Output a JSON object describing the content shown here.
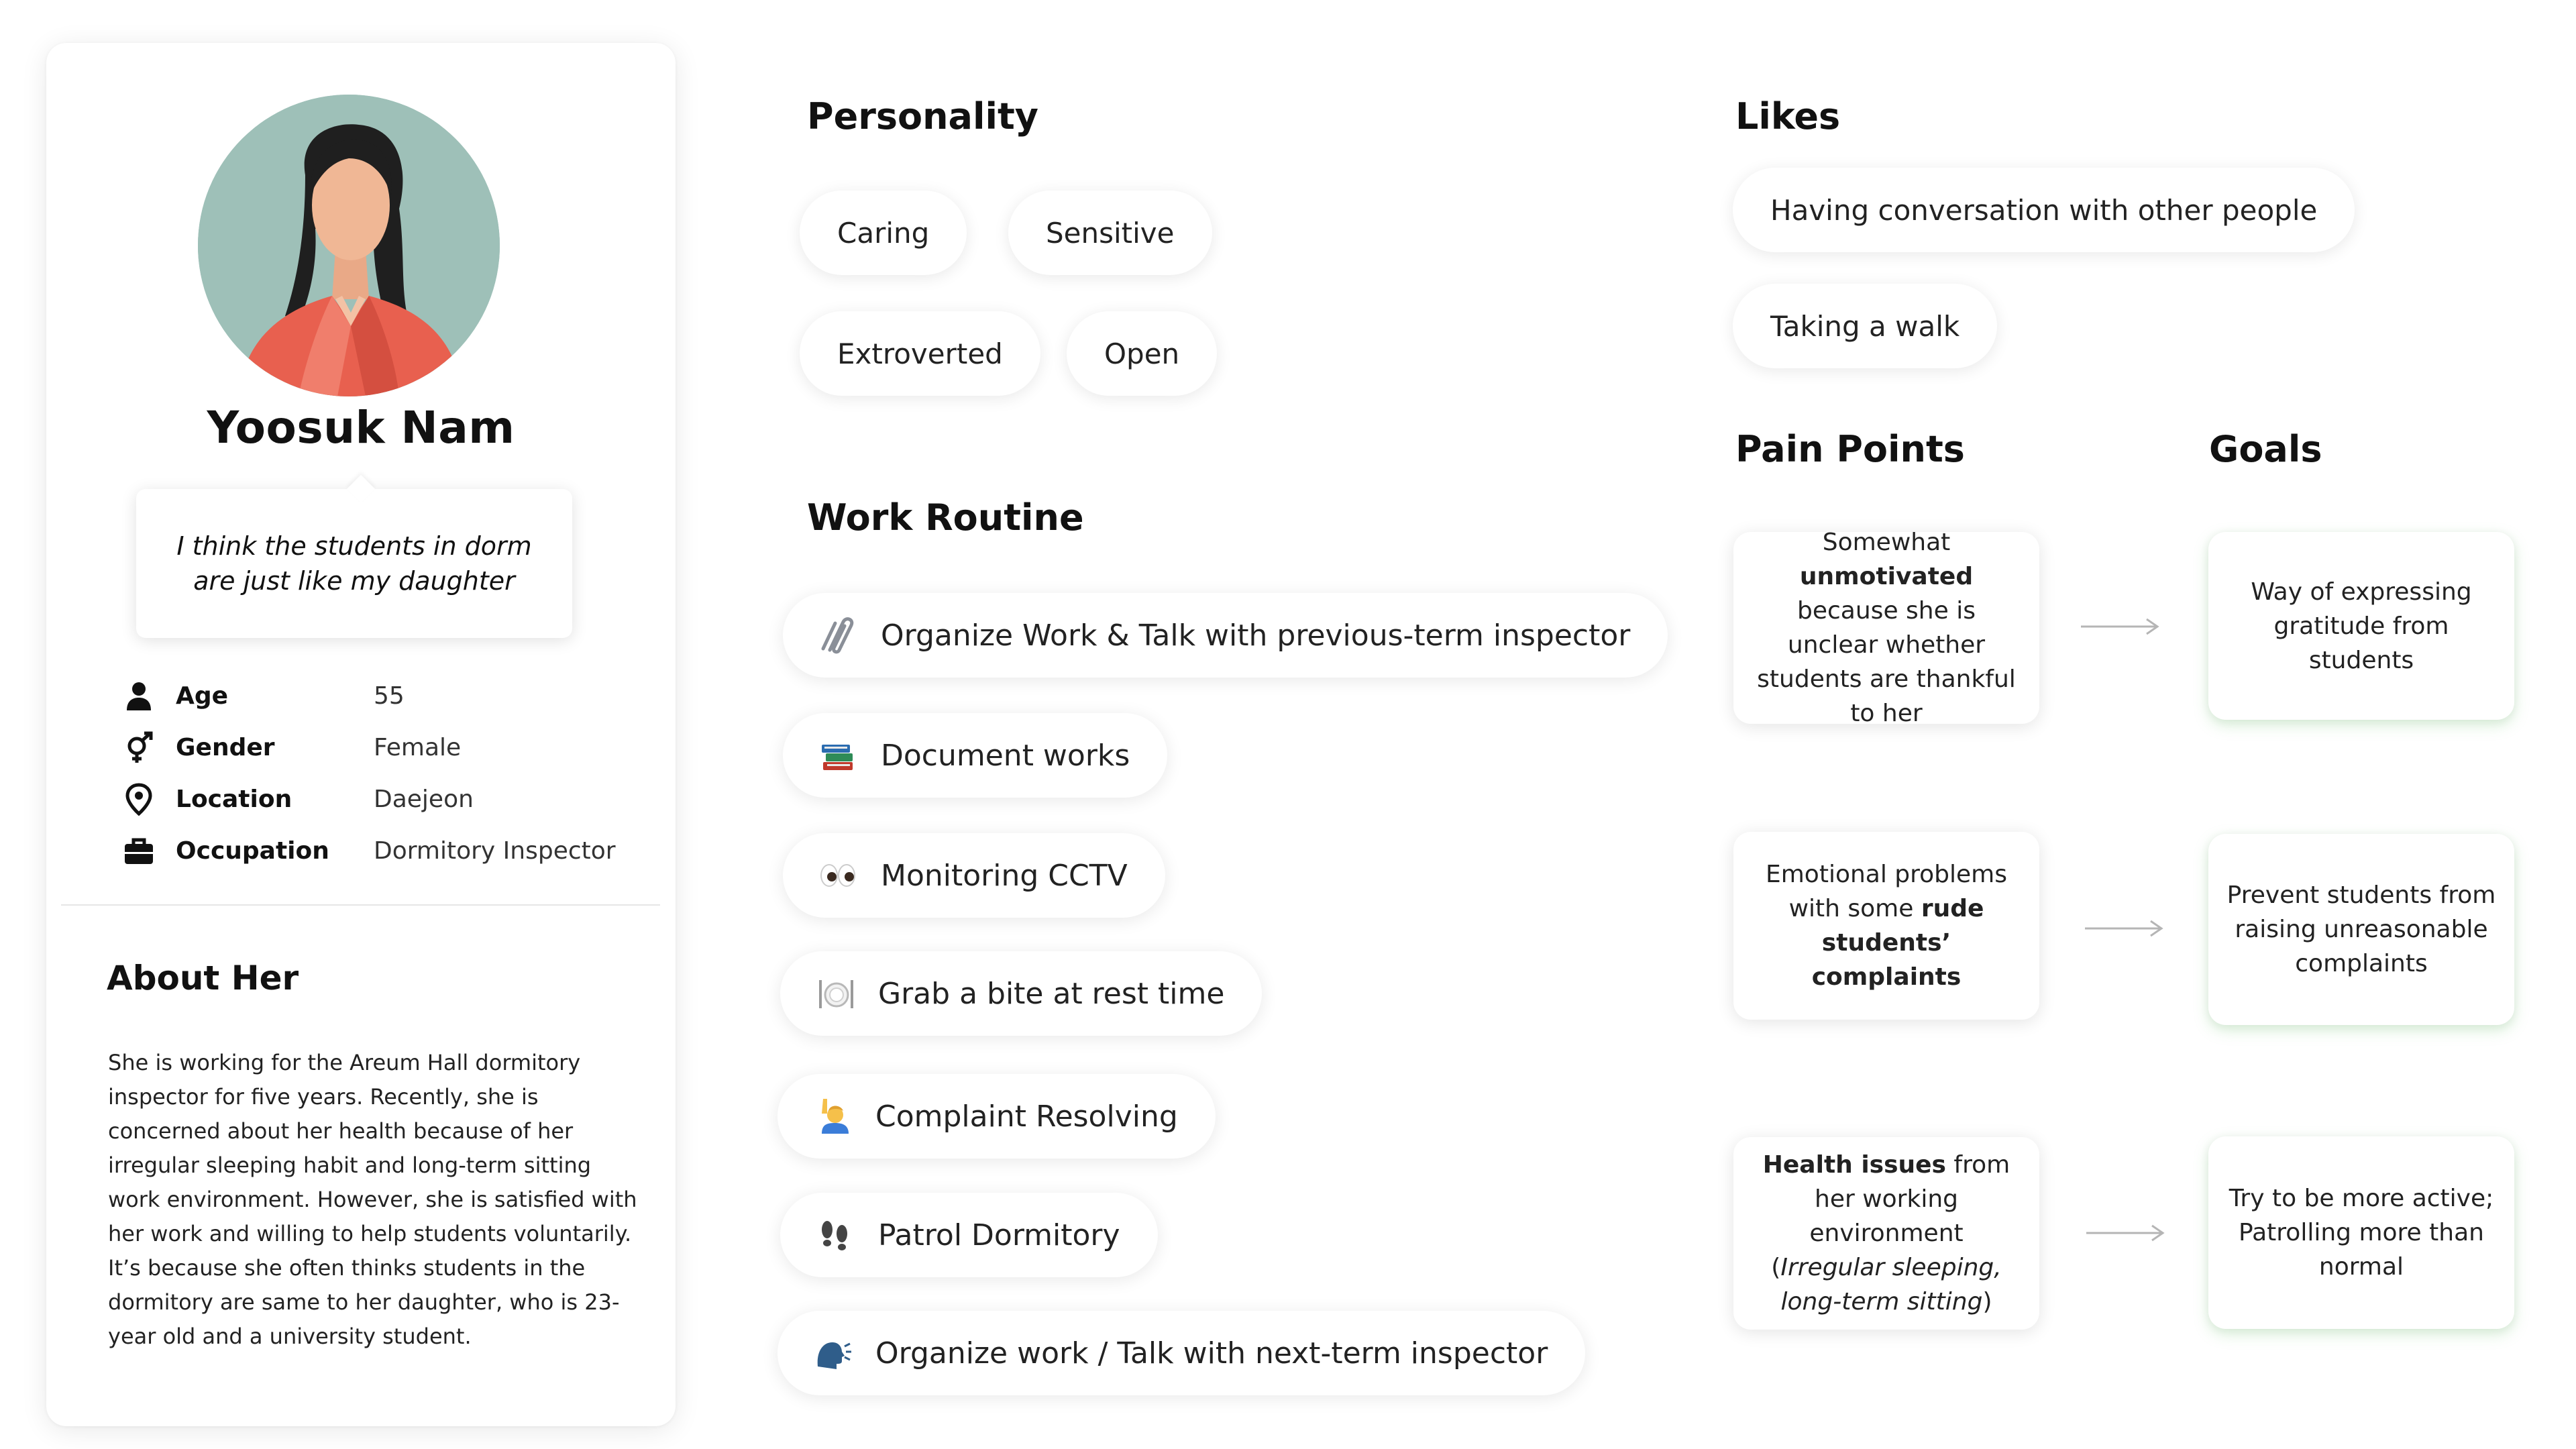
{
  "profile": {
    "name": "Yoosuk Nam",
    "quote": "I think the students in dorm are just like my daughter",
    "info": [
      {
        "icon": "person-icon",
        "label": "Age",
        "value": "55"
      },
      {
        "icon": "gender-icon",
        "label": "Gender",
        "value": "Female"
      },
      {
        "icon": "location-pin-icon",
        "label": "Location",
        "value": "Daejeon"
      },
      {
        "icon": "briefcase-icon",
        "label": "Occupation",
        "value": "Dormitory Inspector"
      }
    ],
    "about_title": "About Her",
    "about_text": "She is working for the Areum Hall dormitory inspector for five years. Recently, she is concerned about her health because of her irregular sleeping habit and long-term sitting work environment. However, she is satisfied with her work and willing to help students voluntarily. It’s because she often thinks students in the dormitory are same to her daughter, who is 23-year old and a university student."
  },
  "personality": {
    "title": "Personality",
    "traits": [
      "Caring",
      "Sensitive",
      "Extroverted",
      "Open"
    ]
  },
  "work_routine": {
    "title": "Work Routine",
    "items": [
      {
        "icon": "paperclip-icon",
        "label": "Organize Work & Talk with previous-term inspector"
      },
      {
        "icon": "books-icon",
        "label": "Document works"
      },
      {
        "icon": "eyes-icon",
        "label": "Monitoring CCTV"
      },
      {
        "icon": "plate-cutlery-icon",
        "label": "Grab a bite at rest time"
      },
      {
        "icon": "raising-hand-icon",
        "label": "Complaint Resolving"
      },
      {
        "icon": "footprints-icon",
        "label": "Patrol Dormitory"
      },
      {
        "icon": "speaking-head-icon",
        "label": "Organize work / Talk with next-term inspector"
      }
    ]
  },
  "likes": {
    "title": "Likes",
    "items": [
      "Having conversation with other people",
      "Taking a walk"
    ]
  },
  "pain_points": {
    "title": "Pain Points",
    "items": [
      {
        "p1": "Somewhat ",
        "b1": "unmotivated",
        "p2": " because she is unclear whether students are thankful to her"
      },
      {
        "p1": "Emotional problems with some ",
        "b1": "rude students’ complaints"
      },
      {
        "b1": "Health issues",
        "p1": " from her working environment (",
        "i1": "Irregular sleeping, long-term sitting",
        "p2": ")"
      }
    ]
  },
  "goals": {
    "title": "Goals",
    "items": [
      "Way of expressing gratitude from students",
      "Prevent students from raising unreasonable complaints",
      "Try to be more active; Patrolling more than normal"
    ]
  },
  "colors": {
    "avatar_bg": "#9ec0b8",
    "jacket": "#e8604f",
    "goal_glow": "#9fdc9f"
  }
}
